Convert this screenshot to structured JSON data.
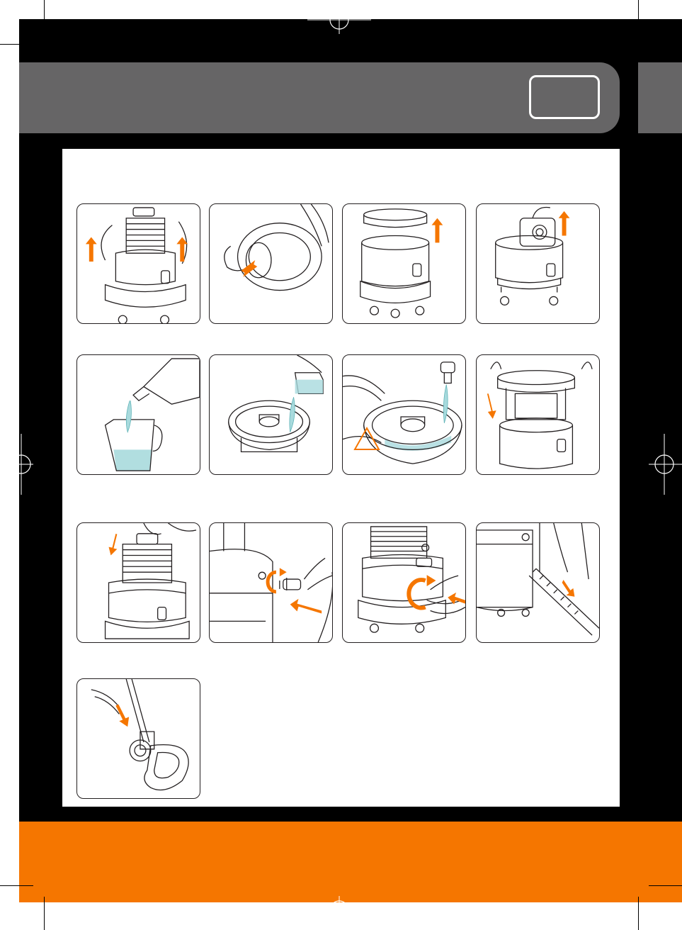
{
  "page": {
    "header_tab_label": "",
    "accent_color": "#f57600",
    "header_color": "#666566",
    "background_color": "#000000"
  },
  "steps": [
    {
      "illustration": "lift-motor-head-icon",
      "arrow_color": "#f57600"
    },
    {
      "illustration": "remove-filter-icon",
      "arrow_color": "#f57600"
    },
    {
      "illustration": "lift-tray-icon",
      "arrow_color": "#f57600"
    },
    {
      "illustration": "remove-dust-bag-icon",
      "arrow_color": "#f57600"
    },
    {
      "illustration": "pour-detergent-icon",
      "arrow_color": "#f57600"
    },
    {
      "illustration": "fill-water-tray-icon",
      "arrow_color": "#f57600"
    },
    {
      "illustration": "fill-tray-from-tap-icon",
      "warning_icon": "warning-triangle-icon"
    },
    {
      "illustration": "place-tray-icon",
      "arrow_color": "#f57600"
    },
    {
      "illustration": "refit-motor-head-icon",
      "arrow_color": "#f57600"
    },
    {
      "illustration": "insert-hose-adapter-icon",
      "arrow_color": "#f57600"
    },
    {
      "illustration": "attach-hose-icon",
      "arrow_color": "#f57600"
    },
    {
      "illustration": "connect-hose-clip-icon",
      "arrow_color": "#f57600"
    },
    {
      "illustration": "attach-spray-nozzle-icon",
      "arrow_color": "#f57600"
    }
  ]
}
